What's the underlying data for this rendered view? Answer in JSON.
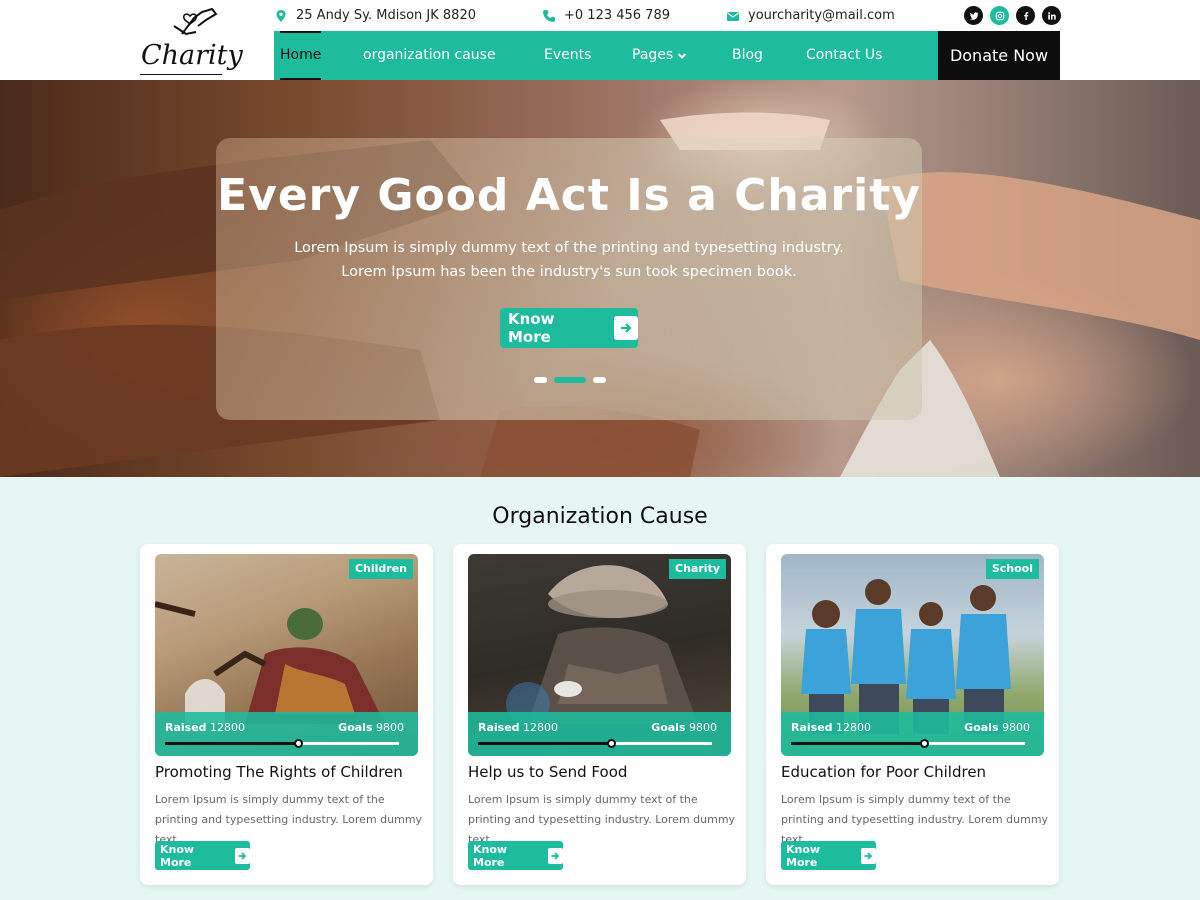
{
  "header": {
    "logo_text": "Charity",
    "address": "25 Andy Sy. Mdison JK 8820",
    "phone": "+0 123 456 789",
    "email": "yourcharity@mail.com",
    "socials": [
      "twitter-icon",
      "instagram-icon",
      "facebook-icon",
      "linkedin-icon"
    ]
  },
  "nav": {
    "items": [
      "Home",
      "organization cause",
      "Events",
      "Pages",
      "Blog",
      "Contact Us"
    ],
    "active": "Home",
    "donate_label": "Donate Now"
  },
  "hero": {
    "title": "Every Good Act Is a Charity",
    "text": "Lorem Ipsum is simply dummy text of the printing and typesetting industry. Lorem Ipsum has been the industry's sun took  specimen book.",
    "button_label": "Know More",
    "slides": 3,
    "active_slide": 2
  },
  "cause": {
    "title": "Organization Cause",
    "cards": [
      {
        "tag": "Children",
        "raised_label": "Raised",
        "raised": "12800",
        "goals_label": "Goals",
        "goals": "9800",
        "progress": 0.57,
        "title": "Promoting The Rights of Children",
        "text": "Lorem Ipsum is simply dummy text of the printing and typesetting industry. Lorem dummy text",
        "button_label": "Know More"
      },
      {
        "tag": "Charity",
        "raised_label": "Raised",
        "raised": "12800",
        "goals_label": "Goals",
        "goals": "9800",
        "progress": 0.57,
        "title": "Help us to Send Food",
        "text": "Lorem Ipsum is simply dummy text of the printing and typesetting industry. Lorem dummy text .",
        "button_label": "Know More"
      },
      {
        "tag": "School",
        "raised_label": "Raised",
        "raised": "12800",
        "goals_label": "Goals",
        "goals": "9800",
        "progress": 0.57,
        "title": "Education for Poor Children",
        "text": "Lorem Ipsum is simply dummy text of the printing and typesetting industry. Lorem dummy text .",
        "button_label": "Know More"
      }
    ]
  },
  "colors": {
    "accent": "#1dbc9c",
    "dark": "#0d0d0d",
    "section_bg": "#e6f6f2"
  }
}
